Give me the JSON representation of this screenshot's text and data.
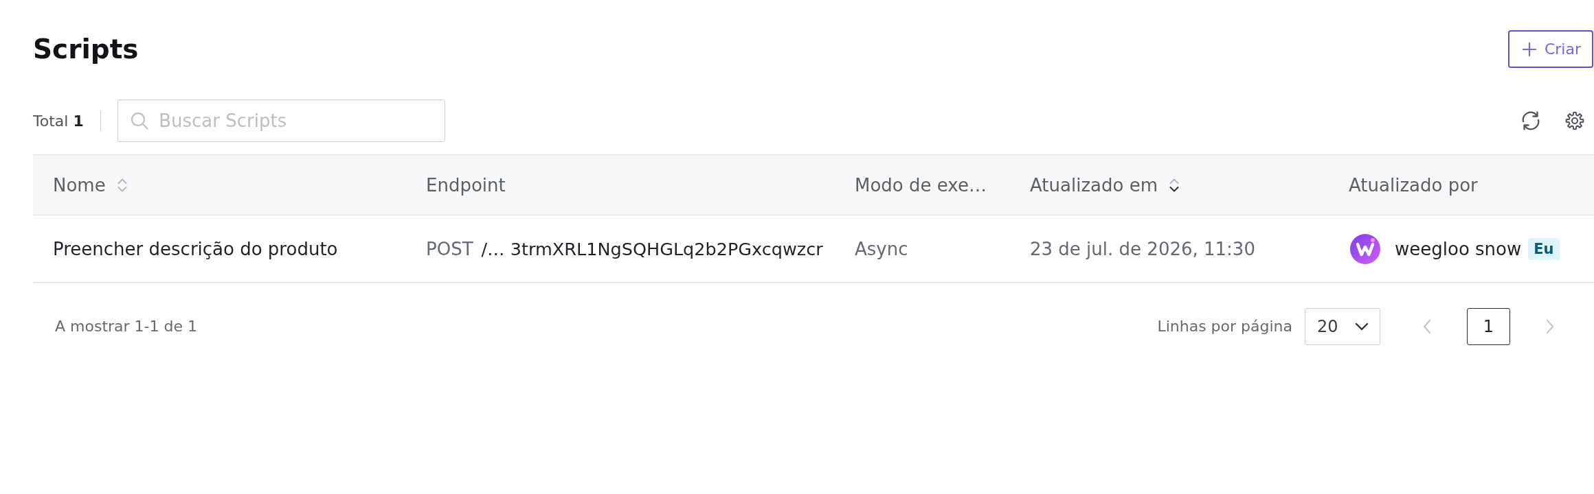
{
  "header": {
    "title": "Scripts",
    "create_button": {
      "label": "Criar"
    }
  },
  "toolbar": {
    "total": "Total **1**",
    "search": {
      "placeholder": "Buscar Scripts"
    }
  },
  "table": {
    "columns": [
      {
        "label": "Nome",
        "sortable": true,
        "sorted_descending": false
      },
      {
        "label": "Endpoint"
      },
      {
        "label": "Modo de exe…"
      },
      {
        "label": "Atualizado em",
        "sortable": true,
        "sorted_descending": true
      },
      {
        "label": "Atualizado por"
      }
    ],
    "rows": [
      {
        "name": "Preencher descrição do produto",
        "method": "POST",
        "endpoint": "/… 3trmXRL1NgSQHGLq2b2PGxcqwzcr",
        "mode": "Async",
        "updated_at": "23 de jul. de 2026, 11:30",
        "updated_by": {
          "name": "weegloo snow",
          "badge": "Eu"
        }
      }
    ]
  },
  "pagination": {
    "summary": "A mostrar 1-1 de 1",
    "rows_per_page_label": "Linhas por página",
    "rows_per_page": "20",
    "prev": {
      "disabled": true
    },
    "pages": [
      {
        "label": "1",
        "selected": true
      }
    ],
    "next": {
      "disabled": true
    }
  }
}
